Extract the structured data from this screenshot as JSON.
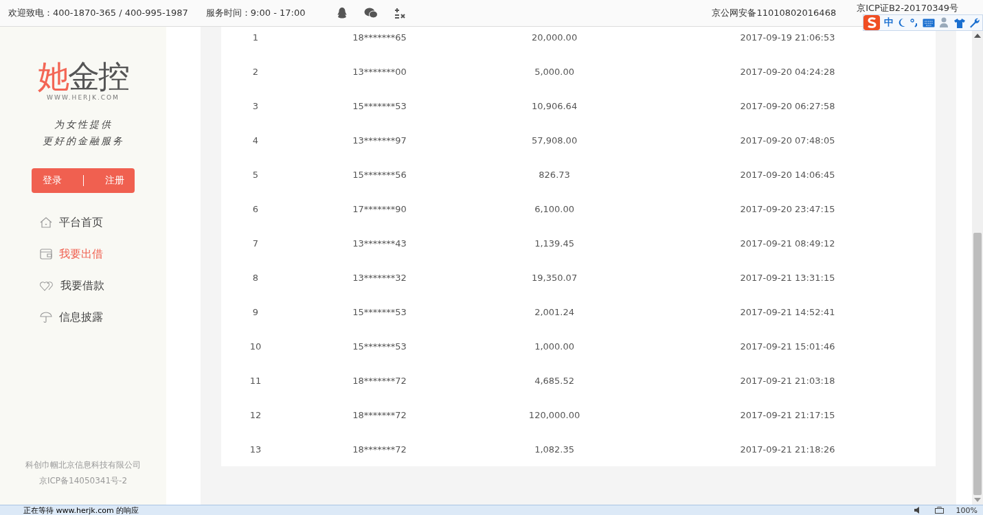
{
  "top_bar": {
    "hotline": "欢迎致电：400-1870-365 / 400-995-1987",
    "service_hours": "服务时间：9:00 - 17:00",
    "police_record": "京公网安备11010802016468",
    "icp": "京ICP证B2-20170349号"
  },
  "ime_toolbar": {
    "mode": "中"
  },
  "sidebar": {
    "logo": {
      "accent": "她",
      "rest": "金控",
      "url": "WWW.HERJK.COM"
    },
    "slogan": [
      "为女性提供",
      "更好的金融服务"
    ],
    "login": "登录",
    "register": "注册",
    "nav": [
      {
        "label": "平台首页",
        "selected": false
      },
      {
        "label": "我要出借",
        "selected": true
      },
      {
        "label": "我要借款",
        "selected": false
      },
      {
        "label": "信息披露",
        "selected": false
      }
    ],
    "footer": [
      "科创巾帼北京信息科技有限公司",
      "京ICP备14050341号-2"
    ]
  },
  "table": {
    "rows": [
      {
        "index": "1",
        "user": "18*******65",
        "amount": "20,000.00",
        "time": "2017-09-19 21:06:53"
      },
      {
        "index": "2",
        "user": "13*******00",
        "amount": "5,000.00",
        "time": "2017-09-20 04:24:28"
      },
      {
        "index": "3",
        "user": "15*******53",
        "amount": "10,906.64",
        "time": "2017-09-20 06:27:58"
      },
      {
        "index": "4",
        "user": "13*******97",
        "amount": "57,908.00",
        "time": "2017-09-20 07:48:05"
      },
      {
        "index": "5",
        "user": "15*******56",
        "amount": "826.73",
        "time": "2017-09-20 14:06:45"
      },
      {
        "index": "6",
        "user": "17*******90",
        "amount": "6,100.00",
        "time": "2017-09-20 23:47:15"
      },
      {
        "index": "7",
        "user": "13*******43",
        "amount": "1,139.45",
        "time": "2017-09-21 08:49:12"
      },
      {
        "index": "8",
        "user": "13*******32",
        "amount": "19,350.07",
        "time": "2017-09-21 13:31:15"
      },
      {
        "index": "9",
        "user": "15*******53",
        "amount": "2,001.24",
        "time": "2017-09-21 14:52:41"
      },
      {
        "index": "10",
        "user": "15*******53",
        "amount": "1,000.00",
        "time": "2017-09-21 15:01:46"
      },
      {
        "index": "11",
        "user": "18*******72",
        "amount": "4,685.52",
        "time": "2017-09-21 21:03:18"
      },
      {
        "index": "12",
        "user": "18*******72",
        "amount": "120,000.00",
        "time": "2017-09-21 21:17:15"
      },
      {
        "index": "13",
        "user": "18*******72",
        "amount": "1,082.35",
        "time": "2017-09-21 21:18:26"
      }
    ]
  },
  "status_bar": {
    "text": "正在等待 www.herjk.com 的响应",
    "zoom": "100%"
  }
}
